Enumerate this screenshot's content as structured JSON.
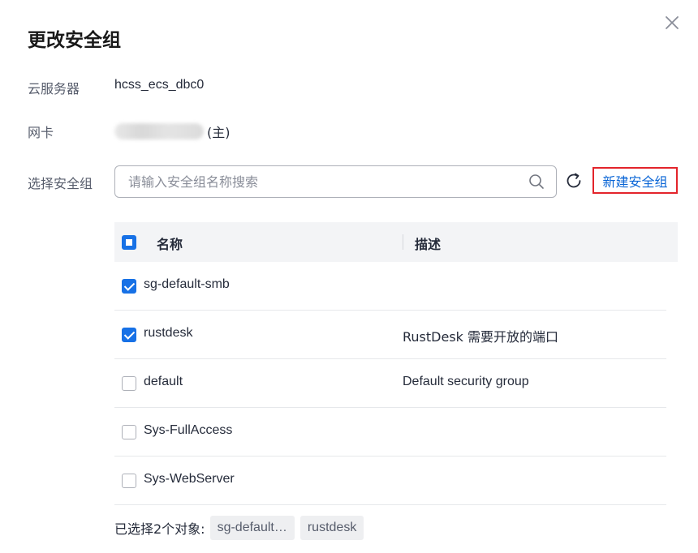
{
  "dialog": {
    "title": "更改安全组"
  },
  "fields": {
    "server_label": "云服务器",
    "server_value": "hcss_ecs_dbc0",
    "nic_label": "网卡",
    "nic_suffix": "(主)",
    "select_label": "选择安全组"
  },
  "search": {
    "placeholder": "请输入安全组名称搜索",
    "value": ""
  },
  "actions": {
    "create_label": "新建安全组"
  },
  "table": {
    "columns": [
      "名称",
      "描述"
    ],
    "rows": [
      {
        "name": "sg-default-smb",
        "description": "",
        "checked": true
      },
      {
        "name": "rustdesk",
        "description": "RustDesk 需要开放的端口",
        "checked": true
      },
      {
        "name": "default",
        "description": "Default security group",
        "checked": false
      },
      {
        "name": "Sys-FullAccess",
        "description": "",
        "checked": false
      },
      {
        "name": "Sys-WebServer",
        "description": "",
        "checked": false
      }
    ]
  },
  "selection": {
    "label": "已选择2个对象:",
    "tags": [
      "sg-default…",
      "rustdesk"
    ]
  },
  "colors": {
    "accent": "#1771e6",
    "link": "#0b66d6",
    "highlight_border": "#e3242b"
  }
}
